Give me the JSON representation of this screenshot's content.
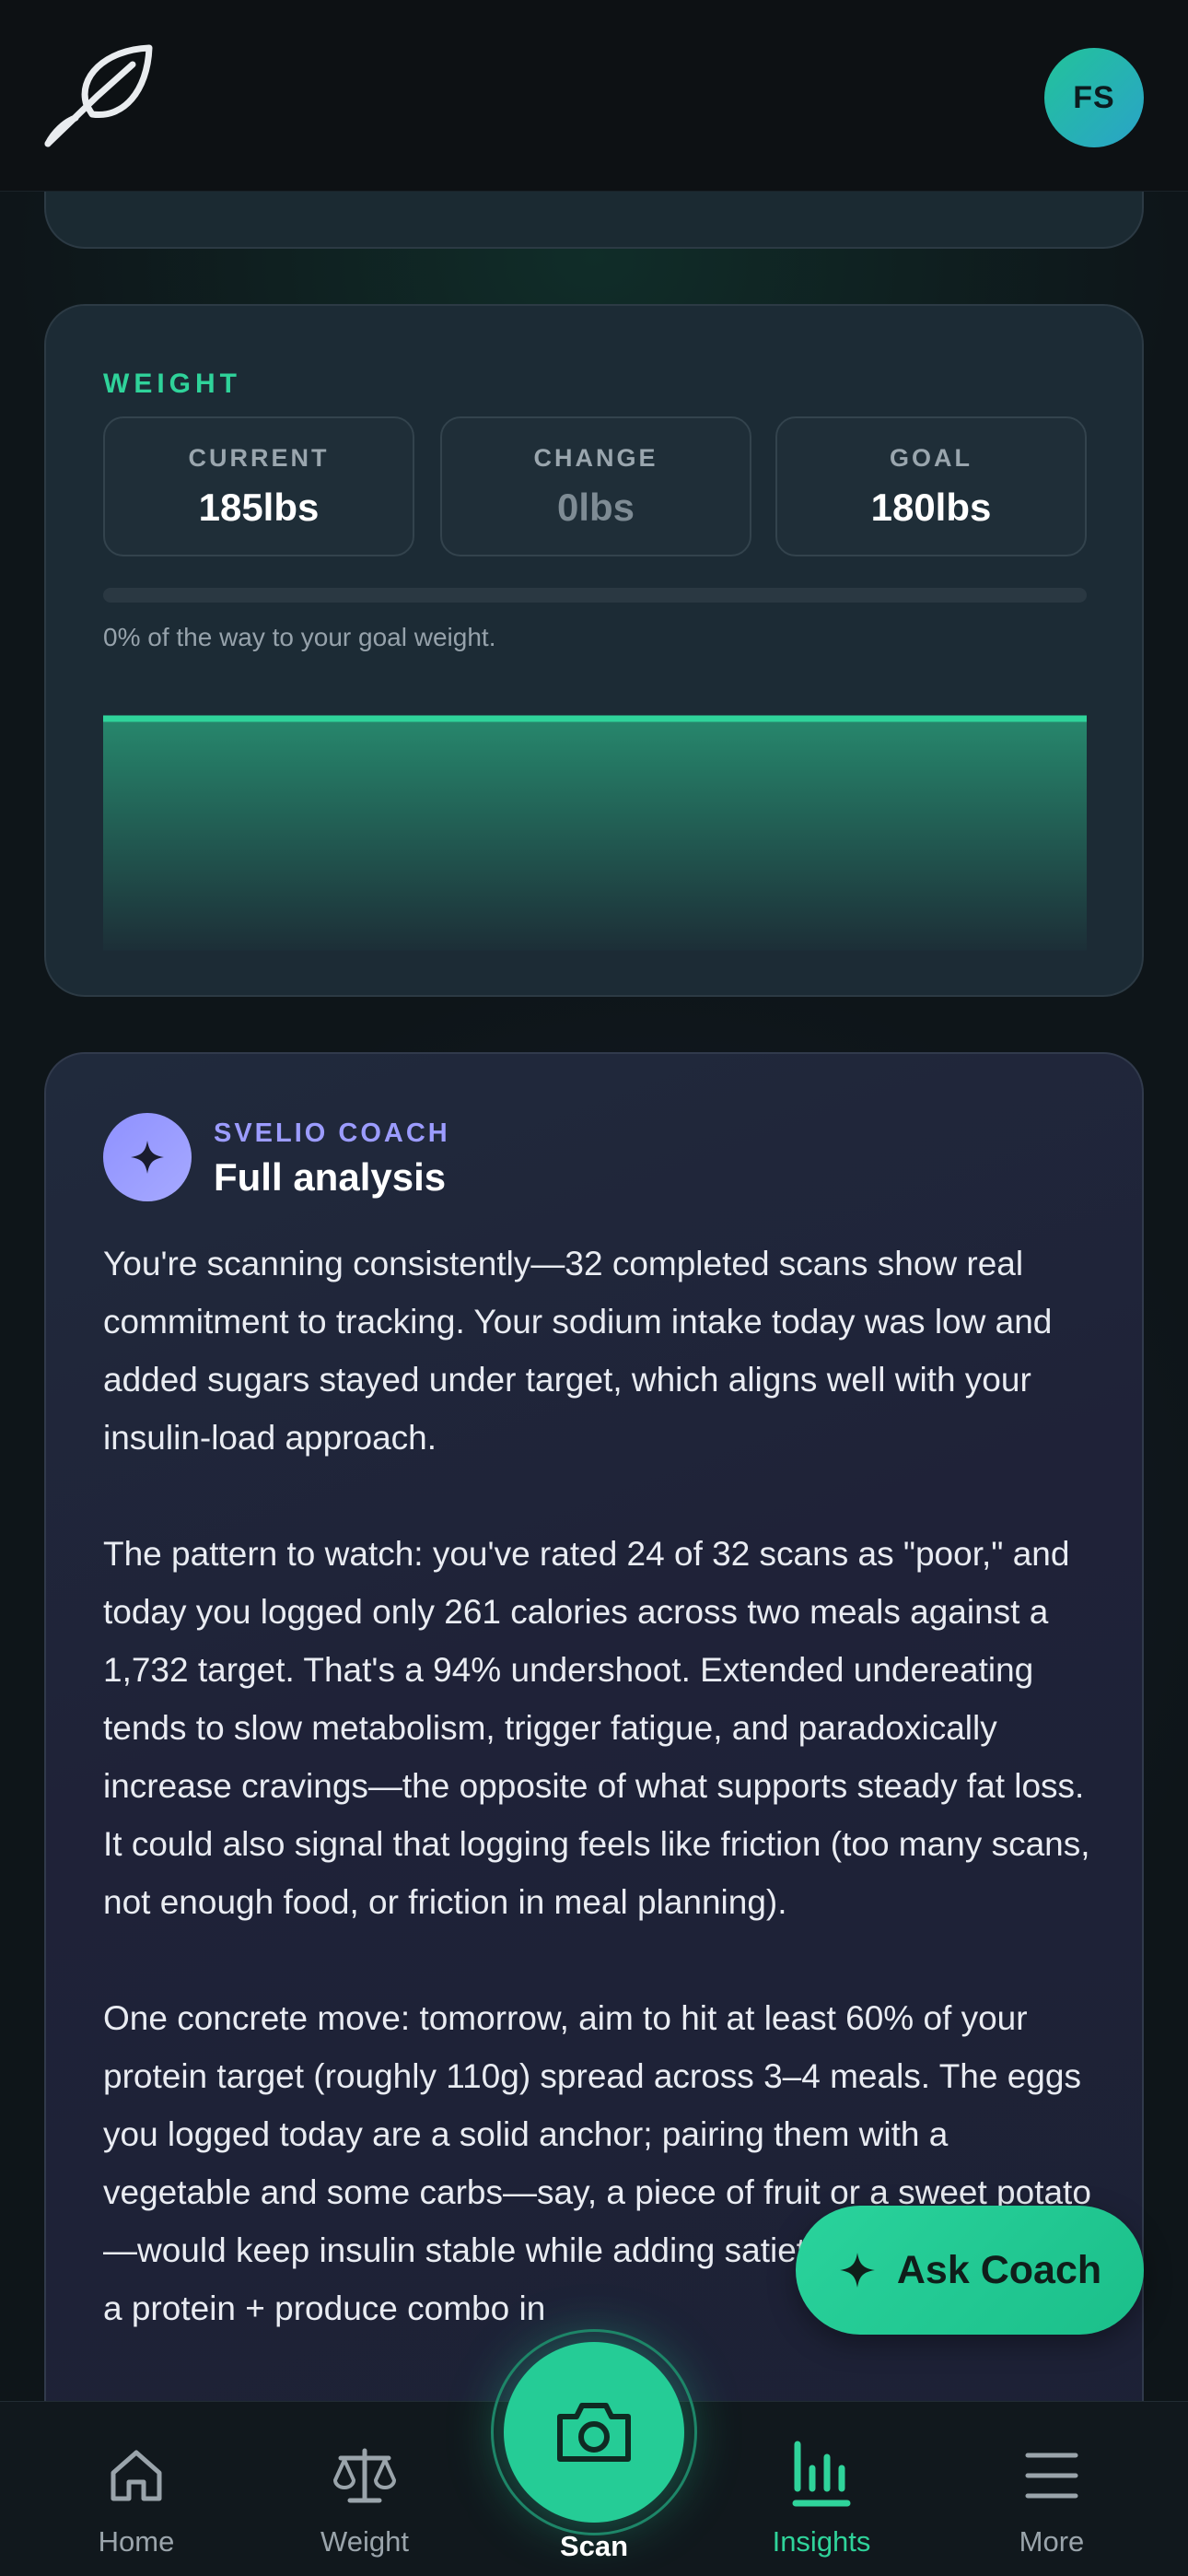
{
  "header": {
    "avatar_initials": "FS",
    "logo_icon": "leaf-icon"
  },
  "weight_card": {
    "section_label": "WEIGHT",
    "stats": [
      {
        "label": "CURRENT",
        "value": "185lbs"
      },
      {
        "label": "CHANGE",
        "value": "0lbs"
      },
      {
        "label": "GOAL",
        "value": "180lbs"
      }
    ],
    "progress_fraction": 0,
    "progress_text": "0% of the way to your goal weight.",
    "chart_data": {
      "type": "area",
      "values": [
        185,
        185
      ],
      "series_color": "#2fd39a"
    }
  },
  "coach_card": {
    "kicker": "SVELIO COACH",
    "title": "Full analysis",
    "paragraphs": [
      "You're scanning consistently—32 completed scans show real commitment to tracking. Your sodium intake today was low and added sugars stayed under target, which aligns well with your insulin-load approach.",
      "The pattern to watch: you've rated 24 of 32 scans as \"poor,\" and today you logged only 261 calories across two meals against a 1,732 target. That's a 94% undershoot. Extended undereating tends to slow metabolism, trigger fatigue, and paradoxically increase cravings—the opposite of what supports steady fat loss. It could also signal that logging feels like friction (too many scans, not enough food, or friction in meal planning).",
      "One concrete move: tomorrow, aim to hit at least 60% of your protein target (roughly 110g) spread across 3–4 meals. The eggs you logged today are a solid anchor; pairing them with a vegetable and some carbs—say, a piece of fruit or a sweet potato—would keep insulin stable while adding satiety. Check if there's a protein + produce combo in"
    ]
  },
  "fab": {
    "label": "Ask Coach"
  },
  "nav": {
    "items": [
      {
        "label": "Home",
        "icon": "home-icon"
      },
      {
        "label": "Weight",
        "icon": "scale-icon"
      },
      {
        "label": "Scan",
        "icon": "camera-icon"
      },
      {
        "label": "Insights",
        "icon": "chart-icon"
      },
      {
        "label": "More",
        "icon": "menu-icon"
      }
    ],
    "active": "Insights"
  },
  "colors": {
    "accent": "#2fd39a",
    "coach_accent": "#9c9cff",
    "background": "#0e1519"
  }
}
